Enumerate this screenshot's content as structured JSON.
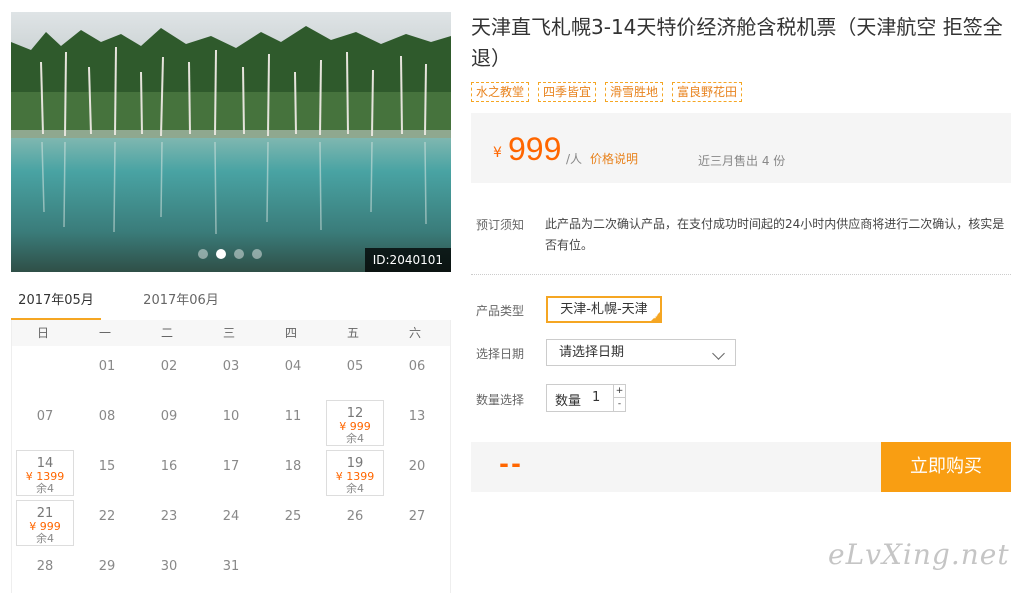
{
  "photo": {
    "id_label": "ID:2040101",
    "slides": 4,
    "active_slide": 2
  },
  "calendar": {
    "tabs": [
      "2017年05月",
      "2017年06月"
    ],
    "active_tab": 0,
    "weekdays": [
      "日",
      "一",
      "二",
      "三",
      "四",
      "五",
      "六"
    ],
    "leading_blanks": 1,
    "days": [
      {
        "d": "01"
      },
      {
        "d": "02"
      },
      {
        "d": "03"
      },
      {
        "d": "04"
      },
      {
        "d": "05"
      },
      {
        "d": "06"
      },
      {
        "d": "07"
      },
      {
        "d": "08"
      },
      {
        "d": "09"
      },
      {
        "d": "10"
      },
      {
        "d": "11"
      },
      {
        "d": "12",
        "price": "¥ 999",
        "stock": "余4"
      },
      {
        "d": "13"
      },
      {
        "d": "14",
        "price": "¥ 1399",
        "stock": "余4"
      },
      {
        "d": "15"
      },
      {
        "d": "16"
      },
      {
        "d": "17"
      },
      {
        "d": "18"
      },
      {
        "d": "19",
        "price": "¥ 1399",
        "stock": "余4"
      },
      {
        "d": "20"
      },
      {
        "d": "21",
        "price": "¥ 999",
        "stock": "余4"
      },
      {
        "d": "22"
      },
      {
        "d": "23"
      },
      {
        "d": "24"
      },
      {
        "d": "25"
      },
      {
        "d": "26"
      },
      {
        "d": "27"
      },
      {
        "d": "28"
      },
      {
        "d": "29"
      },
      {
        "d": "30"
      },
      {
        "d": "31"
      }
    ]
  },
  "product": {
    "title": "天津直飞札幌3-14天特价经济舱含税机票（天津航空 拒签全退）",
    "tags": [
      "水之教堂",
      "四季皆宜",
      "滑雪胜地",
      "富良野花田"
    ]
  },
  "price": {
    "currency": "¥",
    "amount": "999",
    "unit": "/人",
    "note_link": "价格说明",
    "sold": "近三月售出 4 份"
  },
  "booking": {
    "notice_label": "预订须知",
    "notice_text": "此产品为二次确认产品，在支付成功时间起的24小时内供应商将进行二次确认，核实是否有位。",
    "type_label": "产品类型",
    "type_option": "天津-札幌-天津",
    "date_label": "选择日期",
    "date_placeholder": "请选择日期",
    "qty_label": "数量选择",
    "qty_field_label": "数量",
    "qty_value": "1",
    "qty_plus": "+",
    "qty_minus": "-"
  },
  "buy": {
    "total": "--",
    "button_label": "立即购买"
  },
  "watermark": "eLvXing.net",
  "colors": {
    "accent": "#f99e12",
    "price": "#ff6600",
    "tag_border": "#f5a623"
  }
}
